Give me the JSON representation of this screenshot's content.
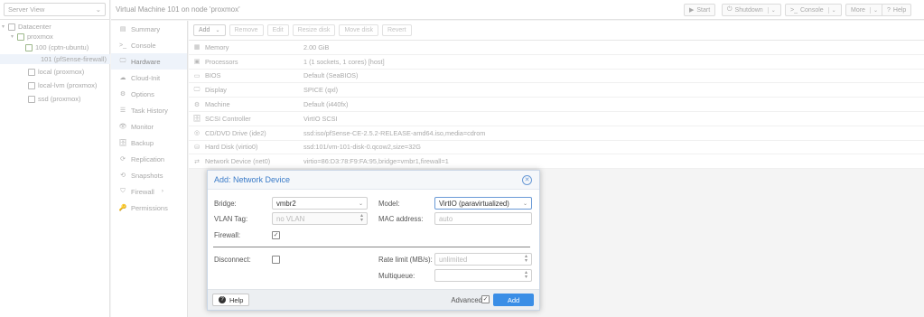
{
  "tree": {
    "view_select": "Server View",
    "items": [
      {
        "label": "Datacenter"
      },
      {
        "label": "proxmox"
      },
      {
        "label": "100 (cptn-ubuntu)"
      },
      {
        "label": "101 (pfSense-firewall)"
      },
      {
        "label": "local (proxmox)"
      },
      {
        "label": "local-lvm (proxmox)"
      },
      {
        "label": "ssd (proxmox)"
      }
    ]
  },
  "header": {
    "title": "Virtual Machine 101 on node 'proxmox'",
    "start": "Start",
    "shutdown": "Shutdown",
    "console": "Console",
    "more": "More",
    "help": "Help"
  },
  "nav": {
    "items": [
      {
        "label": "Summary",
        "icon": "▤"
      },
      {
        "label": "Console",
        "icon": ">_"
      },
      {
        "label": "Hardware",
        "icon": "🖵"
      },
      {
        "label": "Cloud-Init",
        "icon": "☁"
      },
      {
        "label": "Options",
        "icon": "⚙"
      },
      {
        "label": "Task History",
        "icon": "☰"
      },
      {
        "label": "Monitor",
        "icon": "👁"
      },
      {
        "label": "Backup",
        "icon": "🗄"
      },
      {
        "label": "Replication",
        "icon": "⟳"
      },
      {
        "label": "Snapshots",
        "icon": "⟲"
      },
      {
        "label": "Firewall",
        "icon": "⛉"
      },
      {
        "label": "Permissions",
        "icon": "🔑"
      }
    ]
  },
  "toolbar": {
    "add": "Add",
    "remove": "Remove",
    "edit": "Edit",
    "resize": "Resize disk",
    "move": "Move disk",
    "revert": "Revert"
  },
  "hardware": [
    {
      "icon": "▦",
      "name": "Memory",
      "value": "2.00 GiB"
    },
    {
      "icon": "▣",
      "name": "Processors",
      "value": "1 (1 sockets, 1 cores) [host]"
    },
    {
      "icon": "▭",
      "name": "BIOS",
      "value": "Default (SeaBIOS)"
    },
    {
      "icon": "🖵",
      "name": "Display",
      "value": "SPICE (qxl)"
    },
    {
      "icon": "⚙",
      "name": "Machine",
      "value": "Default (i440fx)"
    },
    {
      "icon": "🗄",
      "name": "SCSI Controller",
      "value": "VirtIO SCSI"
    },
    {
      "icon": "◎",
      "name": "CD/DVD Drive (ide2)",
      "value": "ssd:iso/pfSense-CE-2.5.2-RELEASE-amd64.iso,media=cdrom"
    },
    {
      "icon": "⛁",
      "name": "Hard Disk (virtio0)",
      "value": "ssd:101/vm-101-disk-0.qcow2,size=32G"
    },
    {
      "icon": "⇄",
      "name": "Network Device (net0)",
      "value": "virtio=86:D3:78:F9:FA:95,bridge=vmbr1,firewall=1"
    }
  ],
  "modal": {
    "title": "Add: Network Device",
    "bridge_label": "Bridge:",
    "bridge_value": "vmbr2",
    "vlan_label": "VLAN Tag:",
    "vlan_placeholder": "no VLAN",
    "firewall_label": "Firewall:",
    "firewall_checked": true,
    "model_label": "Model:",
    "model_value": "VirtIO (paravirtualized)",
    "mac_label": "MAC address:",
    "mac_placeholder": "auto",
    "disconnect_label": "Disconnect:",
    "disconnect_checked": false,
    "rate_label": "Rate limit (MB/s):",
    "rate_placeholder": "unlimited",
    "multiqueue_label": "Multiqueue:",
    "multiqueue_value": "",
    "help": "Help",
    "advanced_label": "Advanced",
    "advanced_checked": true,
    "add": "Add"
  },
  "colors": {
    "accent": "#3a8ee6",
    "title_blue": "#3a7bc8"
  }
}
